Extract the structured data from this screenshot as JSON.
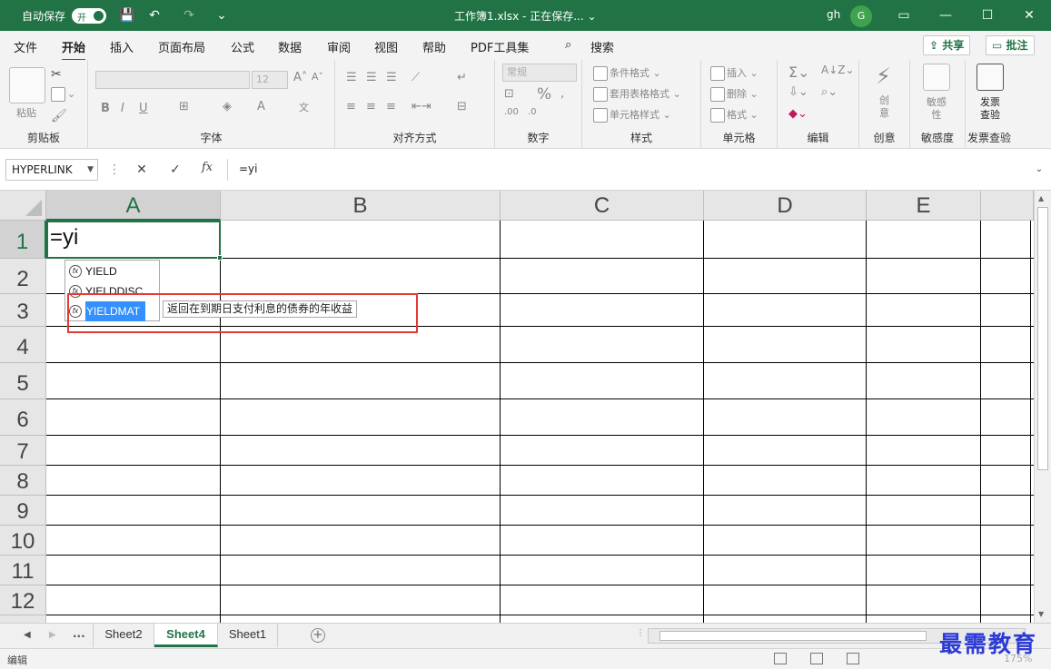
{
  "titlebar": {
    "autosave_label": "自动保存",
    "autosave_state": "开",
    "document_title": "工作簿1.xlsx  -  正在保存... ⌄",
    "user_initials": "gh",
    "avatar_letter": "G",
    "accent_color": "#217346"
  },
  "ribbon_tabs": [
    "文件",
    "开始",
    "插入",
    "页面布局",
    "公式",
    "数据",
    "审阅",
    "视图",
    "帮助",
    "PDF工具集"
  ],
  "search_label": "搜索",
  "share_label": "共享",
  "comments_label": "批注",
  "ribbon": {
    "clipboard": {
      "paste": "粘贴",
      "label": "剪贴板"
    },
    "font": {
      "font_size": "12",
      "label": "字体",
      "bold": "B",
      "italic": "I",
      "underline": "U"
    },
    "alignment": {
      "label": "对齐方式"
    },
    "number": {
      "format": "常规",
      "label": "数字",
      "percent": "%"
    },
    "styles": {
      "conditional": "条件格式",
      "table": "套用表格格式",
      "cell": "单元格样式",
      "label": "样式"
    },
    "cells": {
      "insert": "插入",
      "delete": "删除",
      "format": "格式",
      "label": "单元格"
    },
    "editing": {
      "label": "编辑"
    },
    "creativity": {
      "btn": "创意",
      "label": "创意"
    },
    "sensitivity": {
      "btn": "敏感性",
      "label": "敏感度"
    },
    "invoice": {
      "btn": "发票查验",
      "label": "发票查验"
    }
  },
  "formula_bar": {
    "name_box": "HYPERLINK",
    "cancel": "✕",
    "enter": "✓",
    "fx": "fx",
    "formula": "=yi"
  },
  "columns": [
    "A",
    "B",
    "C",
    "D",
    "E"
  ],
  "rows": [
    "1",
    "2",
    "3",
    "4",
    "5",
    "6",
    "7",
    "8",
    "9",
    "10",
    "11",
    "12"
  ],
  "active_cell_value": "=yi",
  "autocomplete": {
    "items": [
      "YIELD",
      "YIELDDISC",
      "YIELDMAT"
    ],
    "selected": "YIELDMAT",
    "tooltip": "返回在到期日支付利息的债券的年收益"
  },
  "sheets": {
    "ellipsis": "...",
    "tabs": [
      "Sheet2",
      "Sheet4",
      "Sheet1"
    ],
    "active": "Sheet4"
  },
  "status": {
    "mode": "编辑",
    "zoom": "175%"
  },
  "watermark": "最需教育"
}
